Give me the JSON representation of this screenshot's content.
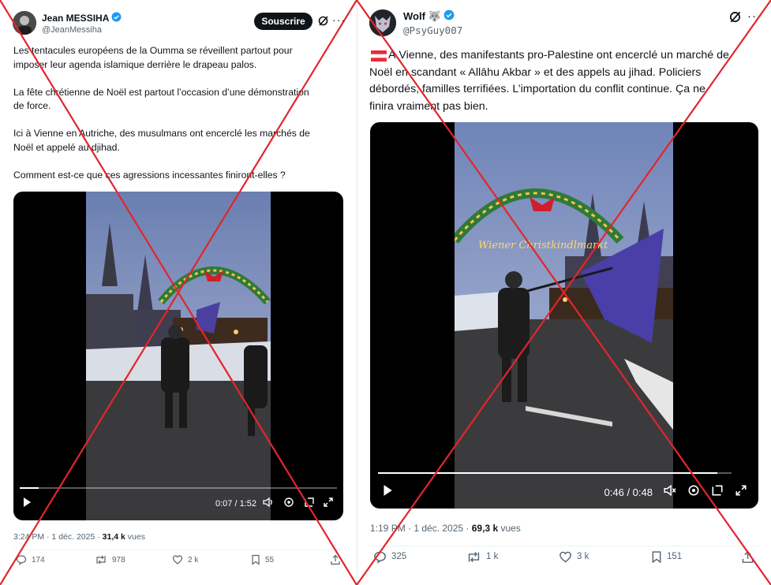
{
  "left": {
    "author_name": "Jean MESSIHA",
    "handle": "@JeanMessiha",
    "subscribe_label": "Souscrire",
    "body": "Les tentacules européens de la Oumma se réveillent partout pour\nimposer leur agenda islamique derrière le drapeau palos.\n\nLa fête chrétienne de Noël est partout l’occasion d’une démonstration\nde force.\n\nIci à Vienne en Autriche, des musulmans ont encerclé les marchés de\nNoël et appelé au djihad.\n\nComment est-ce que ces agressions incessantes finiront-elles ?",
    "video_time": "0:07 / 1:52",
    "video_progress": 0.06,
    "meta_time": "3:24 PM · 1 déc. 2025 · ",
    "views_count": "31,4 k",
    "views_label": " vues",
    "replies": "174",
    "reposts": "978",
    "likes": "2 k",
    "bookmarks": "55"
  },
  "right": {
    "author_name": "Wolf 🐺",
    "handle": "@PsyGuy007",
    "body": "À Vienne, des manifestants pro-Palestine ont encerclé un marché de\nNoël en scandant « Allāhu Akbar » et des appels au jihad. Policiers\ndébordés, familles terrifiées. L’importation du conflit continue. Ça ne\nfinira vraiment pas bien.",
    "video_time": "0:46 / 0:48",
    "video_progress": 0.96,
    "sign_text": "Wiener Christkindlmarkt",
    "meta_time": "1:19 PM · 1 déc. 2025 · ",
    "views_count": "69,3 k",
    "views_label": " vues",
    "replies": "325",
    "reposts": "1 k",
    "likes": "3 k",
    "bookmarks": "151"
  },
  "colors": {
    "verified_blue": "#1d9bf0",
    "cross_red": "#e3252b",
    "muted_text": "#536471"
  }
}
